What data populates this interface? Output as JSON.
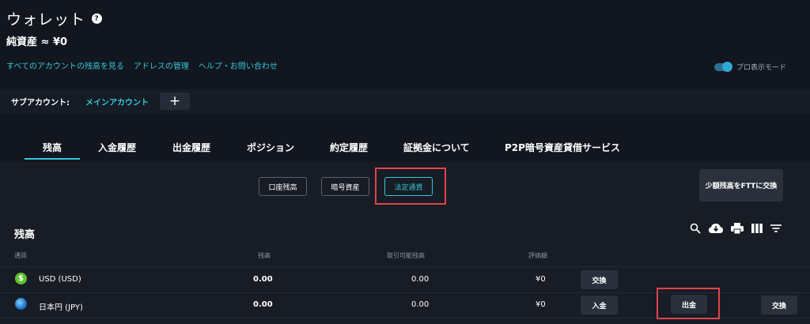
{
  "header": {
    "title": "ウォレット",
    "net_assets": "純資産 ≈ ¥0",
    "links": [
      "すべてのアカウントの残高を見る",
      "アドレスの管理",
      "ヘルプ・お問い合わせ"
    ],
    "pro_mode_label": "プロ表示モード",
    "pro_mode_on": true
  },
  "subaccount": {
    "label": "サブアカウント:",
    "current": "メインアカウント",
    "add_label": "+"
  },
  "tabs": [
    {
      "label": "残高",
      "active": true
    },
    {
      "label": "入金履歴"
    },
    {
      "label": "出金履歴"
    },
    {
      "label": "ポジション"
    },
    {
      "label": "約定履歴"
    },
    {
      "label": "証拠金について"
    },
    {
      "label": "P2P暗号資産貸借サービス"
    }
  ],
  "filters": {
    "items": [
      {
        "label": "口座残高"
      },
      {
        "label": "暗号資産"
      },
      {
        "label": "法定通貨",
        "active": true
      }
    ],
    "small_balance_button": "少額残高をFTTに交換"
  },
  "balances": {
    "title": "残高",
    "columns": [
      "通貨",
      "残高",
      "取引可能残高",
      "評価額"
    ],
    "rows": [
      {
        "currency": "USD (USD)",
        "icon": "usd-coin-icon",
        "balance": "0.00",
        "available": "0.00",
        "value": "¥0",
        "actions": [
          "交換"
        ]
      },
      {
        "currency": "日本円 (JPY)",
        "icon": "jpy-globe-icon",
        "balance": "0.00",
        "available": "0.00",
        "value": "¥0",
        "actions": [
          "入金",
          "出金",
          "交換"
        ]
      }
    ]
  },
  "colors": {
    "background": "#11161f",
    "accent": "#35c7d9",
    "highlight": "#e0444a"
  }
}
